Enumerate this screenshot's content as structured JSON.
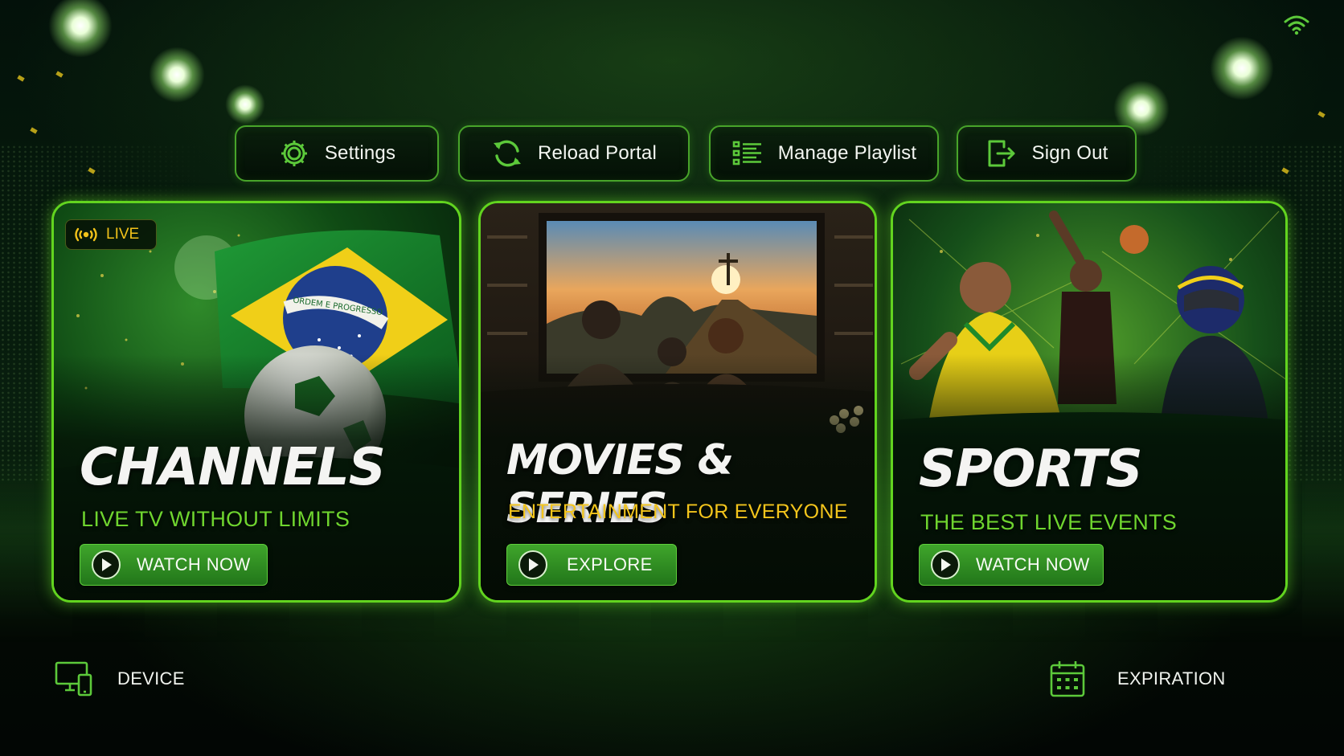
{
  "status": {
    "wifi_icon": "wifi-icon"
  },
  "nav": {
    "settings": {
      "label": "Settings",
      "icon": "gear-icon"
    },
    "reload": {
      "label": "Reload Portal",
      "icon": "refresh-icon"
    },
    "playlist": {
      "label": "Manage Playlist",
      "icon": "list-icon"
    },
    "signout": {
      "label": "Sign Out",
      "icon": "sign-out-icon"
    }
  },
  "cards": {
    "channels": {
      "badge": "LIVE",
      "title": "CHANNELS",
      "subtitle": "LIVE TV WITHOUT LIMITS",
      "cta": "WATCH NOW",
      "subtitle_color": "#6fd52f",
      "flag_text": "ORDEM E PROGRESSO"
    },
    "movies": {
      "title": "MOVIES & SERIES",
      "subtitle": "ENTERTAINMENT FOR EVERYONE",
      "cta": "EXPLORE",
      "subtitle_color": "#f3c51c"
    },
    "sports": {
      "title": "SPORTS",
      "subtitle": "THE BEST LIVE EVENTS",
      "cta": "WATCH NOW",
      "subtitle_color": "#6fd52f"
    }
  },
  "footer": {
    "device": {
      "label": "DEVICE",
      "icon": "device-icon"
    },
    "expiration": {
      "label": "EXPIRATION",
      "icon": "calendar-icon"
    }
  },
  "colors": {
    "accent": "#62d41f",
    "gold": "#f3c51c",
    "background": "#020705"
  }
}
